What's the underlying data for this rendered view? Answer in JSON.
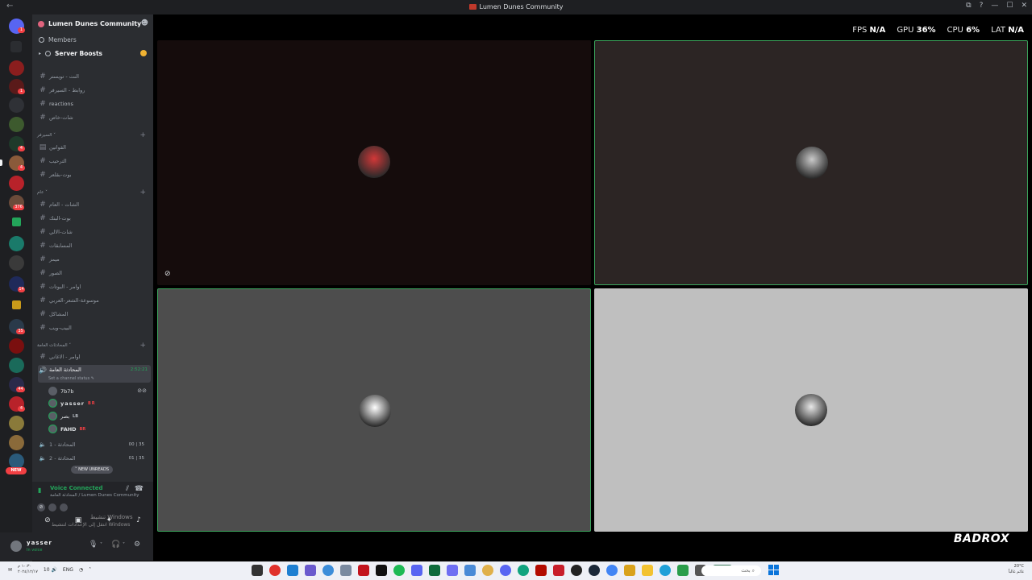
{
  "window": {
    "title": "Lumen Dunes Community",
    "back": "←",
    "controls": [
      "⧉",
      "?",
      "—",
      "☐",
      "✕"
    ]
  },
  "rail": {
    "home_icon": "discord-logo-icon",
    "new_label": "NEW",
    "badges": [
      "1",
      "1",
      "4",
      "4",
      "376",
      "14",
      "35",
      "44",
      "4",
      "16",
      "22"
    ]
  },
  "server_header": {
    "name": "Lumen Dunes Community",
    "chevron": "˅",
    "invite_icon": "add-member-icon"
  },
  "nav": {
    "members": "Members",
    "boosts": "Server Boosts"
  },
  "channels_top": [
    {
      "name": "النت - تويستر"
    },
    {
      "name": "روابط - السيرفر"
    },
    {
      "name": "reactions"
    },
    {
      "name": "شات-خاص"
    }
  ],
  "category_1": {
    "label": "السيرفر"
  },
  "channels_1": [
    {
      "name": "القوانين"
    },
    {
      "name": "الترحيب"
    },
    {
      "name": "بوت-بقلعر"
    }
  ],
  "category_2": {
    "label": "عام"
  },
  "channels_2": [
    {
      "name": "الشات - العام"
    },
    {
      "name": "بوت-البنك"
    },
    {
      "name": "شات-الالي"
    },
    {
      "name": "المسابقات"
    },
    {
      "name": "ميمز"
    },
    {
      "name": "الصور"
    },
    {
      "name": "اوامر - البوتات"
    },
    {
      "name": "موسوعة-الشعر-العربي"
    },
    {
      "name": "المشاكل"
    },
    {
      "name": "البيب-ويب"
    }
  ],
  "category_3": {
    "label": "المحادثات العامة"
  },
  "channels_3": [
    {
      "name": "اوامر - الاغاني"
    }
  ],
  "active_voice": {
    "name": "المحادثة العامة",
    "timer": "2:52:21",
    "status_hint": "Set a channel status"
  },
  "voice_users": [
    {
      "name": "7b7b",
      "tag": ""
    },
    {
      "name": "yasser",
      "tag": "BR"
    },
    {
      "name": "بصر",
      "tag": "LB"
    },
    {
      "name": "FAHD",
      "tag": "BR"
    }
  ],
  "voice_channels": [
    {
      "name": "المحادثة - 1",
      "count_a": "00",
      "count_b": "35"
    },
    {
      "name": "المحادثة - 2",
      "count_a": "01",
      "count_b": "35"
    }
  ],
  "new_unreads": "NEW UNREADS",
  "voice_panel": {
    "title": "Voice Connected",
    "subtitle": "المحادثة العامة / Lumen Dunes Community"
  },
  "windows_watermark": {
    "line1": "تنشيط Windows",
    "line2": "انتقل إلى الإعدادات لتنشيط Windows"
  },
  "user": {
    "name": "yasser",
    "status": "In voice"
  },
  "stats": {
    "fps_label": "FPS",
    "fps": "N/A",
    "gpu_label": "GPU",
    "gpu": "36%",
    "cpu_label": "CPU",
    "cpu": "6%",
    "lat_label": "LAT",
    "lat": "N/A"
  },
  "tiles": [
    {
      "bg": "#150c0c",
      "speaking": false,
      "avatar_color": "#d13838"
    },
    {
      "bg": "#2c2524",
      "speaking": true,
      "avatar_color": "#c9c9c9"
    },
    {
      "bg": "#4d4d4d",
      "speaking": true,
      "avatar_color": "#ffffff"
    },
    {
      "bg": "#bfbfbf",
      "speaking": false,
      "avatar_color": "#e8e8e8"
    }
  ],
  "brand": "BADROX",
  "taskbar": {
    "clock_time": "١٠:٣٠ م",
    "clock_date": "٢٠٢٤/١٢/١٧",
    "lang": "ENG",
    "volume": "10",
    "search_placeholder": "بحث",
    "weather_temp": "20°C",
    "weather_desc": "غائم غالباً"
  },
  "colors": {
    "accent_green": "#23a55a",
    "danger": "#f23f43",
    "sidebar_bg": "#2b2d31",
    "rail_bg": "#1e1f22"
  }
}
